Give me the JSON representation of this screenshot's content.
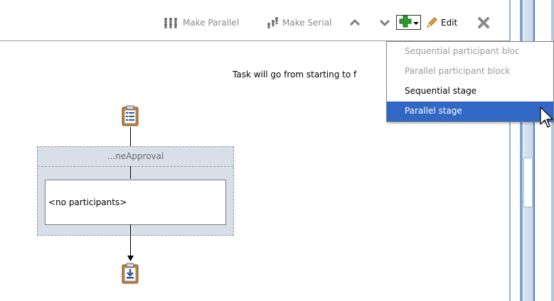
{
  "toolbar": {
    "make_parallel": "Make Parallel",
    "make_serial": "Make Serial",
    "edit": "Edit",
    "icons": [
      "parallel-icon",
      "serial-icon",
      "move-up-icon",
      "move-down-icon",
      "add-icon",
      "chevron-down-icon",
      "pencil-icon",
      "delete-icon"
    ]
  },
  "flow": {
    "description": "Task will go from starting to f",
    "stage_label": "...neApproval",
    "participants_placeholder": "<no participants>"
  },
  "add_menu": {
    "items": [
      {
        "label": "Sequential participant bloc",
        "state": "disabled"
      },
      {
        "label": "Parallel participant block",
        "state": "disabled"
      },
      {
        "label": "Sequential stage",
        "state": "enabled"
      },
      {
        "label": "Parallel stage",
        "state": "selected"
      }
    ]
  },
  "colors": {
    "selection": "#3168c6",
    "stage_fill": "#d8dfe8",
    "add_green": "#2e9b2e"
  }
}
